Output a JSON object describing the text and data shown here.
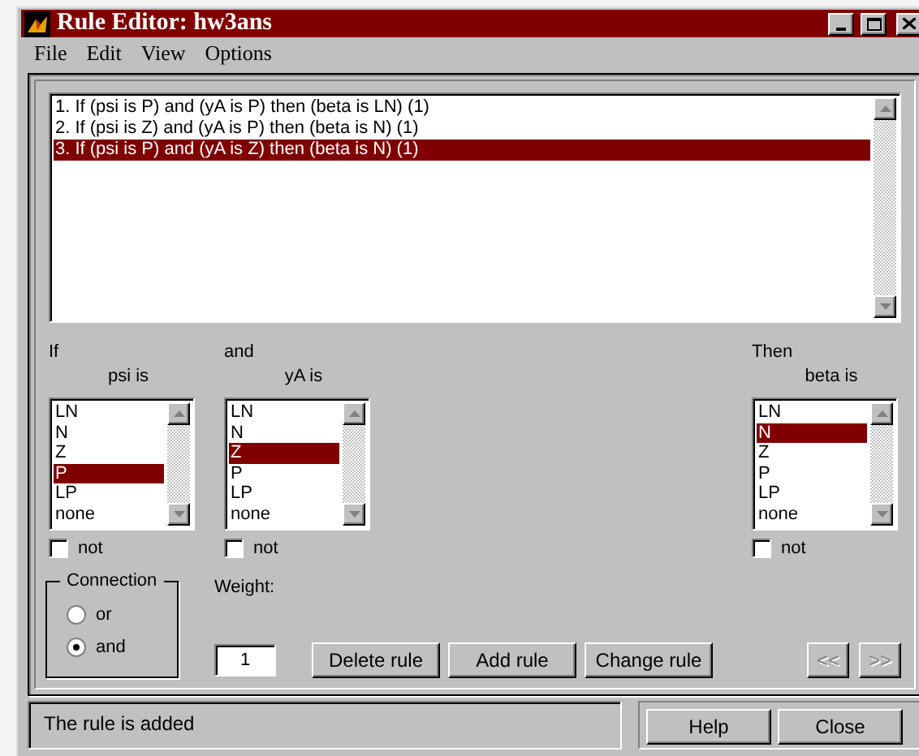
{
  "window": {
    "title": "Rule Editor: hw3ans"
  },
  "menu": [
    "File",
    "Edit",
    "View",
    "Options"
  ],
  "rules": [
    {
      "text": "1. If (psi is P) and (yA is P) then (beta is LN) (1)",
      "selected": false
    },
    {
      "text": "2. If (psi is Z) and (yA is P) then (beta is N) (1)",
      "selected": false
    },
    {
      "text": "3. If (psi is P) and (yA is Z) then (beta is N) (1)",
      "selected": true
    }
  ],
  "antecedents": [
    {
      "connector": "If",
      "label": "psi is",
      "options": [
        {
          "label": "LN",
          "selected": false
        },
        {
          "label": "N",
          "selected": false
        },
        {
          "label": "Z",
          "selected": false
        },
        {
          "label": "P",
          "selected": true
        },
        {
          "label": "LP",
          "selected": false
        },
        {
          "label": "none",
          "selected": false
        }
      ],
      "not": {
        "label": "not",
        "checked": false
      }
    },
    {
      "connector": "and",
      "label": "yA is",
      "options": [
        {
          "label": "LN",
          "selected": false
        },
        {
          "label": "N",
          "selected": false
        },
        {
          "label": "Z",
          "selected": true
        },
        {
          "label": "P",
          "selected": false
        },
        {
          "label": "LP",
          "selected": false
        },
        {
          "label": "none",
          "selected": false
        }
      ],
      "not": {
        "label": "not",
        "checked": false
      }
    }
  ],
  "consequent": {
    "connector": "Then",
    "label": "beta is",
    "options": [
      {
        "label": "LN",
        "selected": false
      },
      {
        "label": "N",
        "selected": true
      },
      {
        "label": "Z",
        "selected": false
      },
      {
        "label": "P",
        "selected": false
      },
      {
        "label": "LP",
        "selected": false
      },
      {
        "label": "none",
        "selected": false
      }
    ],
    "not": {
      "label": "not",
      "checked": false
    }
  },
  "connection": {
    "title": "Connection",
    "options": [
      {
        "label": "or",
        "selected": false
      },
      {
        "label": "and",
        "selected": true
      }
    ]
  },
  "weight": {
    "label": "Weight:",
    "value": "1"
  },
  "buttons": [
    "Delete rule",
    "Add rule",
    "Change rule"
  ],
  "nav": [
    {
      "label": "<<",
      "disabled": true
    },
    {
      "label": ">>",
      "disabled": true
    }
  ],
  "status": "The rule is added",
  "footer_buttons": [
    "Help",
    "Close"
  ]
}
